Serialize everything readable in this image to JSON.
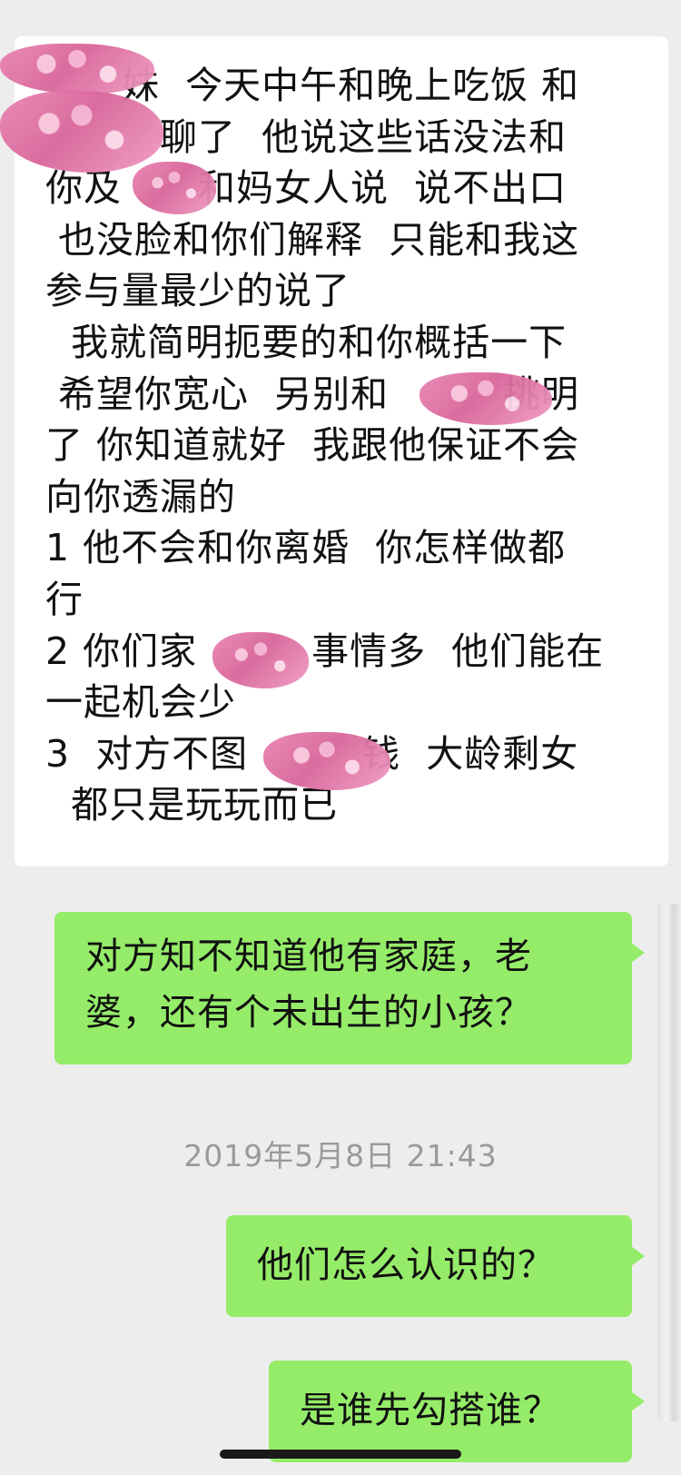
{
  "messages": {
    "incoming": {
      "lines": [
        "　　妹  今天中午和晚上吃饭 和",
        "　　　聊了  他说这些话没法和",
        "你及　　和妈女人说  说不出口",
        " 也没脸和你们解释  只能和我这",
        "参与量最少的说了",
        "  我就简明扼要的和你概括一下",
        " 希望你宽心  另别和　　　挑明",
        "了 你知道就好  我跟他保证不会",
        "向你透漏的",
        "1 他不会和你离婚  你怎样做都",
        "行",
        "2 你们家　　　事情多  他们能在",
        "一起机会少",
        "3  对方不图　　　钱  大龄剩女",
        "  都只是玩玩而已"
      ]
    },
    "outgoing_1": {
      "lines": [
        "对方知不知道他有家庭，老",
        "婆，还有个未出生的小孩？"
      ]
    },
    "timestamp": "2019年5月8日 21:43",
    "outgoing_2": {
      "text": "他们怎么认识的？"
    },
    "outgoing_3": {
      "text": "是谁先勾搭谁？"
    }
  },
  "colors": {
    "background": "#ededed",
    "incoming_bubble": "#ffffff",
    "outgoing_bubble": "#95ec69",
    "timestamp": "#9a9a9a",
    "redaction": "#e98bb7"
  }
}
